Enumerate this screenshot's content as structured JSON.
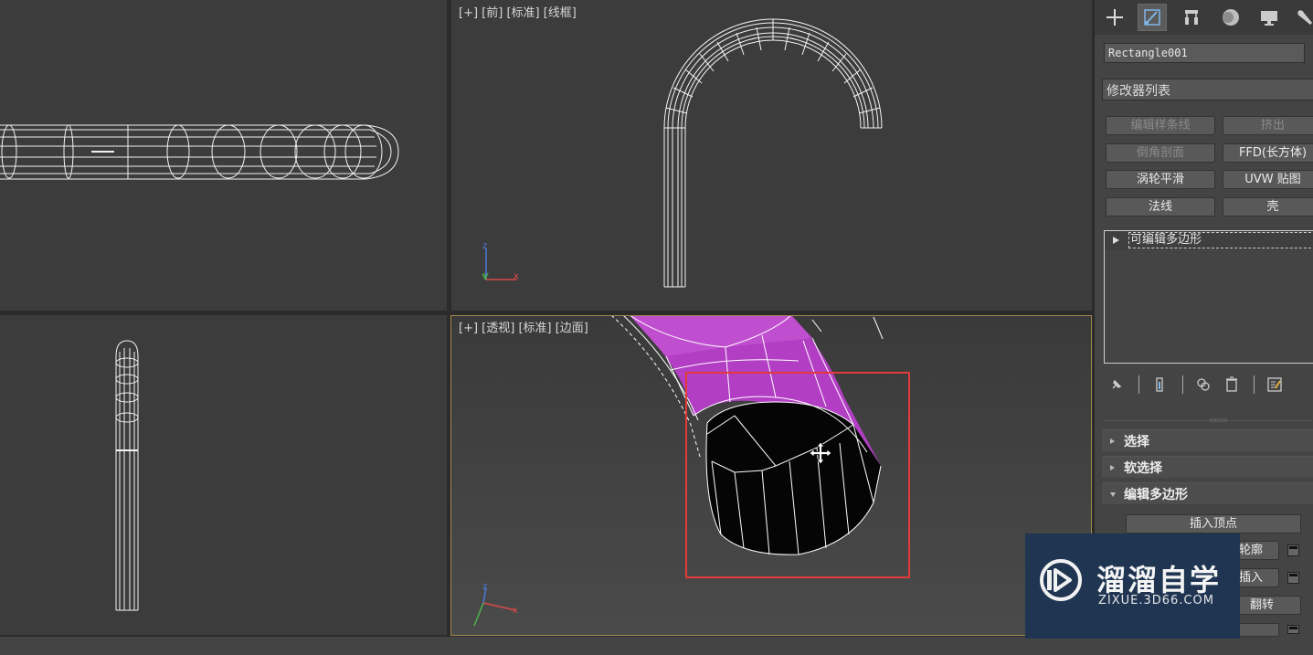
{
  "viewports": {
    "front": {
      "label": "[+] [前] [标准] [线框]"
    },
    "perspective": {
      "label": "[+] [透视] [标准] [边面]"
    }
  },
  "axes": {
    "z": "z",
    "y": "y",
    "x": "x"
  },
  "command_panel": {
    "tabs": [
      "create-icon",
      "modify-icon",
      "hierarchy-icon",
      "motion-icon",
      "display-icon",
      "utilities-icon"
    ],
    "object_name": "Rectangle001",
    "modifier_list": "修改器列表",
    "modifier_buttons": [
      {
        "label": "编辑样条线",
        "enabled": false
      },
      {
        "label": "挤出",
        "enabled": false
      },
      {
        "label": "倒角剖面",
        "enabled": false
      },
      {
        "label": "FFD(长方体)",
        "enabled": true
      },
      {
        "label": "涡轮平滑",
        "enabled": true
      },
      {
        "label": "UVW 贴图",
        "enabled": true
      },
      {
        "label": "法线",
        "enabled": true
      },
      {
        "label": "壳",
        "enabled": true
      }
    ],
    "stack_item": "可编辑多边形",
    "rollouts": {
      "selection": "选择",
      "soft_selection": "软选择",
      "edit_poly": "编辑多边形"
    },
    "edit_poly_buttons": {
      "insert_vertex": "插入顶点",
      "outline": "轮廓",
      "inset": "插入",
      "flip": "翻转"
    }
  },
  "watermark": {
    "brand": "溜溜自学",
    "url": "ZIXUE.3D66.COM"
  },
  "colors": {
    "viewport_bg": "#3c3c3c",
    "wireframe": "#ffffff",
    "mesh_magenta": "#b23ec4",
    "active_border": "#a5864a",
    "highlight_box": "#e03a3a",
    "panel_bg": "#444444"
  }
}
